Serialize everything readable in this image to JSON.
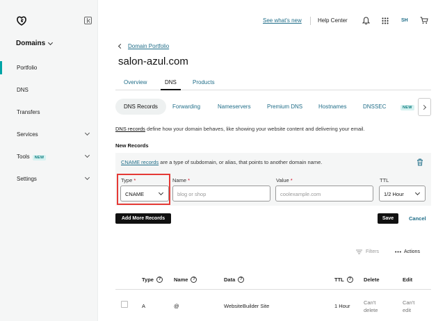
{
  "sidebar": {
    "section_title": "Domains",
    "items": [
      {
        "label": "Portfolio"
      },
      {
        "label": "DNS"
      },
      {
        "label": "Transfers"
      },
      {
        "label": "Services"
      },
      {
        "label": "Tools",
        "badge": "NEW"
      },
      {
        "label": "Settings"
      }
    ]
  },
  "topbar": {
    "see_whats_new": "See what's new",
    "help_center": "Help Center",
    "user_initials": "SH"
  },
  "breadcrumb": {
    "label": "Domain Portfolio"
  },
  "page": {
    "title": "salon-azul.com"
  },
  "tabs": [
    {
      "label": "Overview"
    },
    {
      "label": "DNS"
    },
    {
      "label": "Products"
    }
  ],
  "subtabs": [
    {
      "label": "DNS Records"
    },
    {
      "label": "Forwarding"
    },
    {
      "label": "Nameservers"
    },
    {
      "label": "Premium DNS"
    },
    {
      "label": "Hostnames"
    },
    {
      "label": "DNSSEC"
    },
    {
      "label": "NEW"
    }
  ],
  "description": {
    "link": "DNS records",
    "text": " define how your domain behaves, like showing your website content and delivering your email."
  },
  "new_records": {
    "heading": "New Records",
    "note_link": "CNAME records",
    "note_text": " are a type of subdomain, or alias, that points to another domain name.",
    "fields": {
      "type": {
        "label": "Type",
        "req": "*",
        "value": "CNAME"
      },
      "name": {
        "label": "Name",
        "req": "*",
        "placeholder": "blog or shop"
      },
      "value": {
        "label": "Value",
        "req": "*",
        "placeholder": "coolexample.com"
      },
      "ttl": {
        "label": "TTL",
        "value": "1/2 Hour"
      }
    },
    "add_more": "Add More Records",
    "save": "Save",
    "cancel": "Cancel"
  },
  "toolbar": {
    "filters": "Filters",
    "actions": "Actions"
  },
  "table": {
    "headers": {
      "type": "Type",
      "name": "Name",
      "data": "Data",
      "ttl": "TTL",
      "delete": "Delete",
      "edit": "Edit"
    },
    "help_glyph": "?",
    "rows": [
      {
        "type": "A",
        "name": "@",
        "data": "WebsiteBuilder Site",
        "ttl": "1 Hour",
        "delete_1": "Can't",
        "delete_2": "delete",
        "edit_1": "Can't",
        "edit_2": "edit"
      }
    ]
  },
  "colors": {
    "accent": "#1f6d88",
    "active_bar": "#00a4a6",
    "highlight": "#e53935",
    "required": "#d0021b"
  }
}
